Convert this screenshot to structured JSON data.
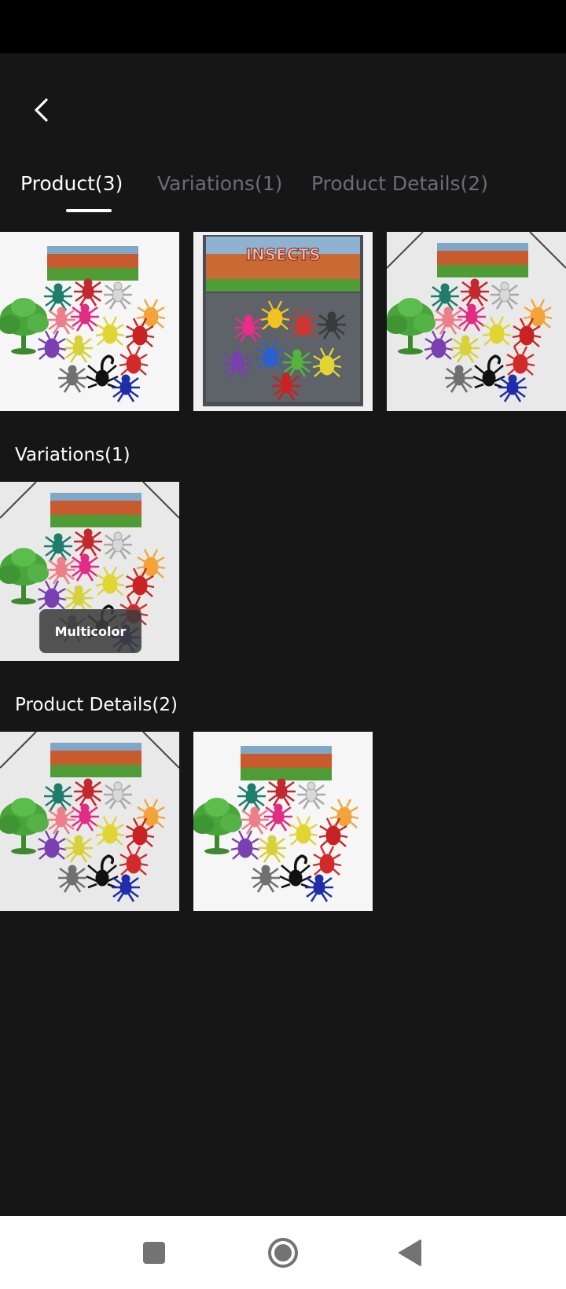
{
  "tabs": [
    {
      "label": "Product(3)",
      "active": true
    },
    {
      "label": "Variations(1)",
      "active": false
    },
    {
      "label": "Product Details(2)",
      "active": false
    }
  ],
  "sections": {
    "product": {
      "image_count": 3
    },
    "variations": {
      "title": "Variations(1)",
      "items": [
        {
          "label": "Multicolor"
        }
      ]
    },
    "product_details": {
      "title": "Product Details(2)",
      "image_count": 2
    }
  },
  "images": {
    "pack_label": "INSECTS"
  },
  "colors": {
    "background": "#161616",
    "status_bar": "#000000",
    "text_primary": "#ffffff",
    "text_inactive": "#6c6c72",
    "nav_bar": "#ffffff"
  },
  "icons": {
    "back": "chevron-left-icon",
    "recents": "square-icon",
    "home": "circle-icon",
    "nav_back": "triangle-back-icon"
  }
}
